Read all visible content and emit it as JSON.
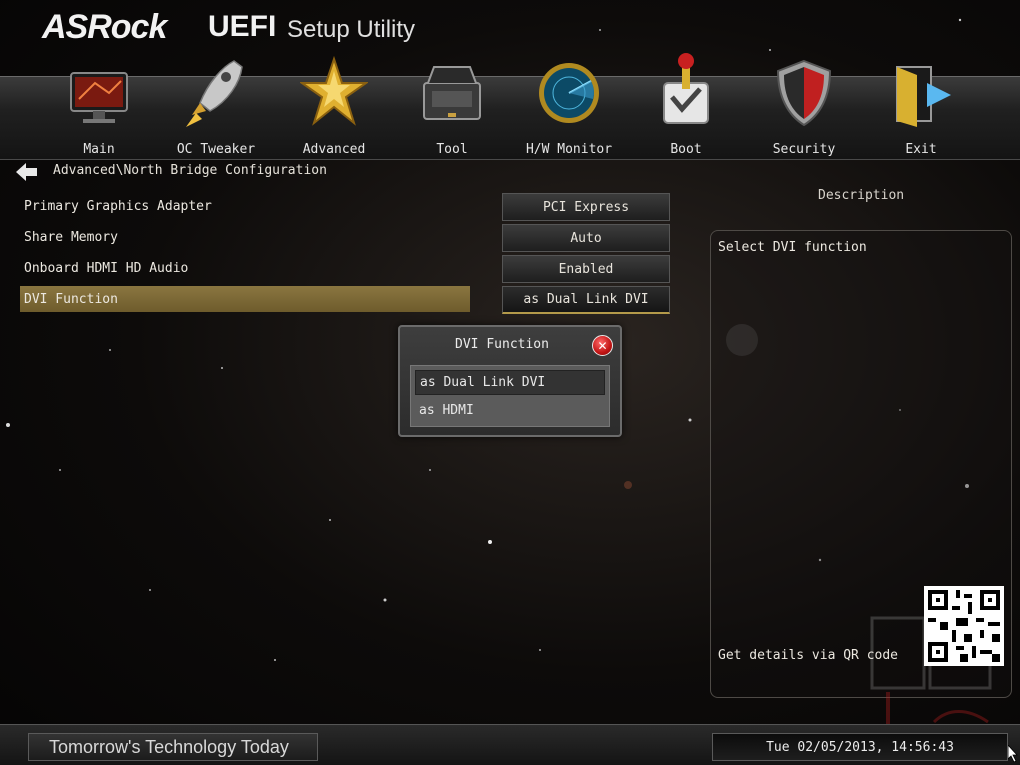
{
  "header": {
    "brand": "ASRock",
    "product": "UEFI",
    "subtitle": "Setup Utility"
  },
  "menu": {
    "tabs": [
      {
        "label": "Main",
        "icon": "monitor-icon"
      },
      {
        "label": "OC Tweaker",
        "icon": "rocket-icon"
      },
      {
        "label": "Advanced",
        "icon": "star-icon"
      },
      {
        "label": "Tool",
        "icon": "toolbox-icon"
      },
      {
        "label": "H/W Monitor",
        "icon": "radar-icon"
      },
      {
        "label": "Boot",
        "icon": "boot-switch-icon"
      },
      {
        "label": "Security",
        "icon": "shield-icon"
      },
      {
        "label": "Exit",
        "icon": "exit-door-icon"
      }
    ],
    "active": "Advanced"
  },
  "breadcrumb": "Advanced\\North Bridge Configuration",
  "settings": [
    {
      "label": "Primary Graphics Adapter",
      "value": "PCI Express"
    },
    {
      "label": "Share Memory",
      "value": "Auto"
    },
    {
      "label": "Onboard HDMI HD Audio",
      "value": "Enabled"
    },
    {
      "label": "DVI Function",
      "value": "as Dual Link DVI"
    }
  ],
  "description": {
    "title": "Description",
    "text": "Select DVI function",
    "qr_hint": "Get details via QR code"
  },
  "popup": {
    "title": "DVI Function",
    "options": [
      "as Dual Link DVI",
      "as HDMI"
    ],
    "selected": "as Dual Link DVI"
  },
  "footer": {
    "slogan": "Tomorrow's Technology Today",
    "datetime": "Tue 02/05/2013, 14:56:43"
  },
  "colors": {
    "highlight": "#8a7640",
    "accent_gold": "#b49a4a",
    "close_red": "#c21414"
  }
}
